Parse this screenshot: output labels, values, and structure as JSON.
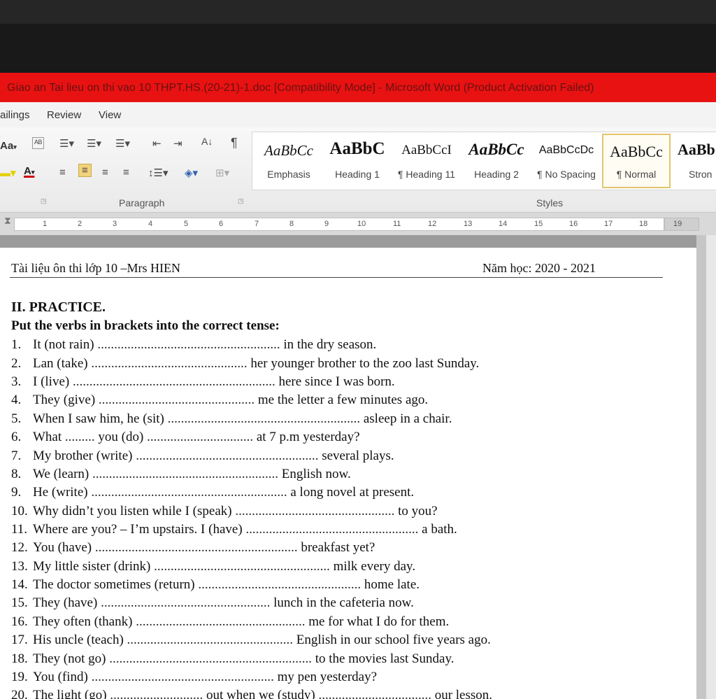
{
  "window": {
    "title": "Giao an  Tai lieu on thi vao 10 THPT.HS.(20-21)-1.doc [Compatibility Mode] - Microsoft Word (Product Activation Failed)"
  },
  "menu": {
    "tabs": [
      "ailings",
      "Review",
      "View"
    ]
  },
  "ribbon": {
    "font_size_btn": "Aa",
    "para_label": "Paragraph",
    "styles_label": "Styles",
    "styles": [
      {
        "preview": "AaBbCc",
        "name": "Emphasis"
      },
      {
        "preview": "AaBbC",
        "name": "Heading 1"
      },
      {
        "preview": "AaBbCcI",
        "name": "¶ Heading 11"
      },
      {
        "preview": "AaBbCc",
        "name": "Heading 2"
      },
      {
        "preview": "AaBbCcDc",
        "name": "¶ No Spacing"
      },
      {
        "preview": "AaBbCc",
        "name": "¶ Normal"
      },
      {
        "preview": "AaBb",
        "name": "Stron"
      }
    ]
  },
  "ruler": {
    "ticks": [
      "1",
      "2",
      "3",
      "4",
      "5",
      "6",
      "7",
      "8",
      "9",
      "10",
      "11",
      "12",
      "13",
      "14",
      "15",
      "16",
      "17",
      "18",
      "19"
    ]
  },
  "document": {
    "header_left": "Tài liệu ôn thi lớp 10 –Mrs HIEN",
    "header_right": "Năm học: 2020 - 2021",
    "section": "II. PRACTICE.",
    "instruction": "Put the verbs in brackets into the correct tense:",
    "exercises": [
      {
        "n": "1.",
        "a": "It (not rain) ",
        "d": ".......................................................",
        "b": " in the dry season."
      },
      {
        "n": "2.",
        "a": "Lan (take) ",
        "d": "...............................................",
        "b": " her younger brother to the zoo last Sunday."
      },
      {
        "n": "3.",
        "a": "I (live) ",
        "d": ".............................................................",
        "b": " here since I was born."
      },
      {
        "n": "4.",
        "a": "They (give) ",
        "d": "...............................................",
        "b": " me the letter a few minutes ago."
      },
      {
        "n": "5.",
        "a": "When I saw him, he (sit) ",
        "d": "..........................................................",
        "b": " asleep in a chair."
      },
      {
        "n": "6.",
        "a": "What ",
        "d": ".........",
        "b": " you (do) ",
        "d2": "................................",
        "c": " at 7 p.m yesterday?"
      },
      {
        "n": "7.",
        "a": "My brother (write) ",
        "d": ".......................................................",
        "b": " several plays."
      },
      {
        "n": "8.",
        "a": "We (learn) ",
        "d": "........................................................",
        "b": " English now."
      },
      {
        "n": "9.",
        "a": "He (write) ",
        "d": "...........................................................",
        "b": " a long novel at present."
      },
      {
        "n": "10.",
        "a": "Why didn’t you listen while I (speak) ",
        "d": "................................................",
        "b": " to you?"
      },
      {
        "n": "11.",
        "a": "Where are you? – I’m upstairs. I (have) ",
        "d": "....................................................",
        "b": " a bath."
      },
      {
        "n": "12.",
        "a": "You (have) ",
        "d": ".............................................................",
        "b": " breakfast yet?"
      },
      {
        "n": "13.",
        "a": "My little sister (drink) ",
        "d": ".....................................................",
        "b": " milk every day."
      },
      {
        "n": "14.",
        "a": "The doctor sometimes (return) ",
        "d": ".................................................",
        "b": " home late."
      },
      {
        "n": "15.",
        "a": "They (have) ",
        "d": "...................................................",
        "b": " lunch in the cafeteria now."
      },
      {
        "n": "16.",
        "a": "They often (thank) ",
        "d": "...................................................",
        "b": " me for what I do for them."
      },
      {
        "n": "17.",
        "a": "His uncle (teach) ",
        "d": "..................................................",
        "b": " English in our school five years ago."
      },
      {
        "n": "18.",
        "a": "They (not go) ",
        "d": ".............................................................",
        "b": " to the movies last Sunday."
      },
      {
        "n": "19.",
        "a": "You (find) ",
        "d": ".......................................................",
        "b": " my pen yesterday?"
      },
      {
        "n": "20.",
        "a": "The light (go) ",
        "d": "............................",
        "b": " out when we (study) ",
        "d2": "..................................",
        "c": " our lesson."
      }
    ]
  }
}
